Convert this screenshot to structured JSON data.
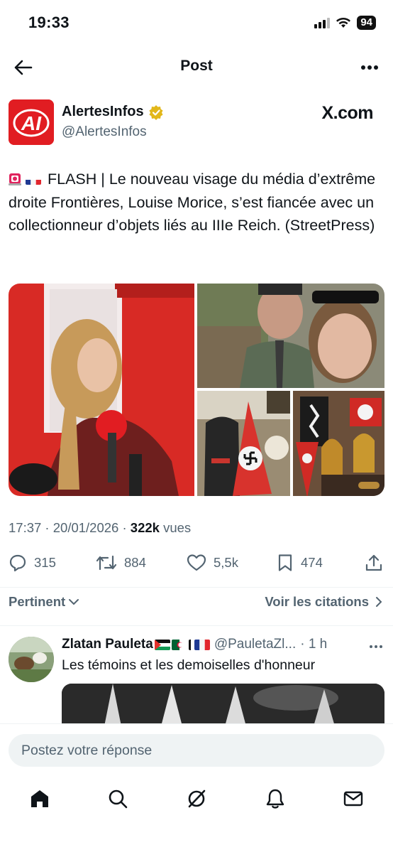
{
  "status_bar": {
    "time": "19:33",
    "battery": "94"
  },
  "header": {
    "title": "Post"
  },
  "author": {
    "name": "AlertesInfos",
    "handle": "@AlertesInfos",
    "logo_text": "AI",
    "source_badge": "X.com"
  },
  "tweet": {
    "text_prefix": "FLASH | Le nouveau visage du média d’extrême droite Frontières, Louise Morice, s’est fiancée avec un collectionneur d’objets liés au IIIe Reich. (StreetPress)",
    "timestamp": "17:37 · 20/01/2026 · ",
    "views_count": "322k",
    "views_label": " vues",
    "media": [
      "photo-red-studio",
      "photo-couple-selfie",
      "photo-uniform-display",
      "photo-collection-room"
    ]
  },
  "actions": {
    "replies": "315",
    "reposts": "884",
    "likes": "5,5k",
    "bookmarks": "474"
  },
  "sort": {
    "left_label": "Pertinent",
    "right_label": "Voir les citations"
  },
  "reply": {
    "name": "Zlatan Pauleta",
    "handle": "@PauletaZl...",
    "time": "· 1 h",
    "text": "Les témoins et les demoiselles d'honneur"
  },
  "composer": {
    "placeholder": "Postez votre réponse"
  },
  "colors": {
    "accent": "#1d9bf0",
    "brand_red": "#e11d22",
    "muted": "#536471",
    "verified_gold": "#e2b719"
  },
  "icons": [
    "back-arrow-icon",
    "more-icon",
    "verified-badge-icon",
    "reply-icon",
    "repost-icon",
    "like-icon",
    "bookmark-icon",
    "share-icon",
    "chevron-down-icon",
    "chevron-right-icon",
    "home-icon",
    "search-icon",
    "grok-icon",
    "notifications-icon",
    "messages-icon"
  ]
}
